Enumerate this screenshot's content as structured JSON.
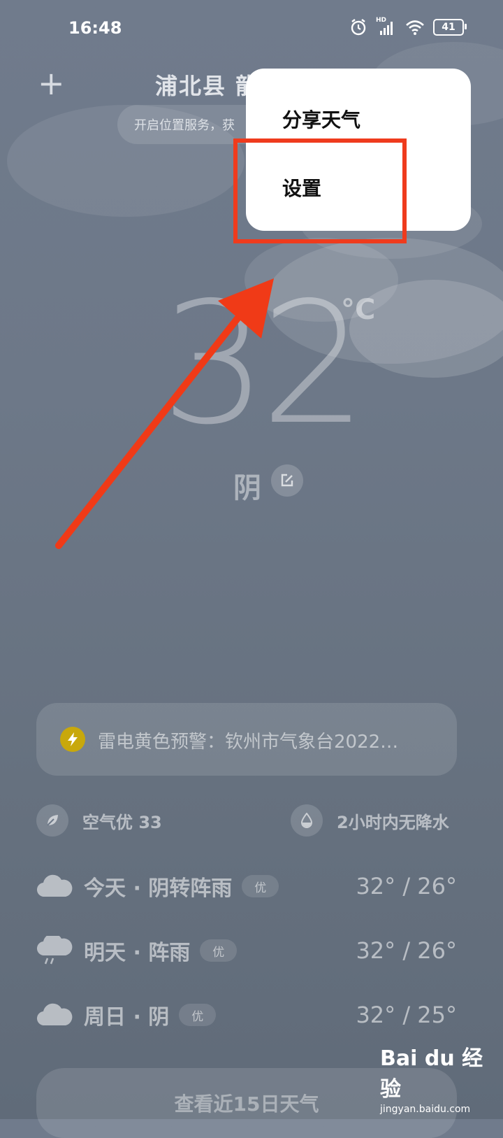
{
  "status": {
    "time": "16:48",
    "battery": "41",
    "network": "HD"
  },
  "header": {
    "add_label": "+",
    "city": "浦北县 龍",
    "location_hint": "开启位置服务，获"
  },
  "menu": {
    "share": "分享天气",
    "settings": "设置"
  },
  "current": {
    "temperature": "32",
    "unit": "°C",
    "condition": "阴"
  },
  "alert": {
    "text": "雷电黄色预警：钦州市气象台2022…",
    "color": "#c8a80b"
  },
  "air": {
    "label": "空气优 33"
  },
  "rain": {
    "label": "2小时内无降水"
  },
  "forecast": [
    {
      "label": "今天 · 阴转阵雨",
      "badge": "优",
      "temp": "32° / 26°",
      "icon": "cloud-icon"
    },
    {
      "label": "明天 · 阵雨",
      "badge": "优",
      "temp": "32° / 26°",
      "icon": "rain-cloud-icon"
    },
    {
      "label": "周日 · 阴",
      "badge": "优",
      "temp": "32° / 25°",
      "icon": "cloud-icon"
    }
  ],
  "bottom_button": "查看近15日天气",
  "watermark": {
    "brand": "Bai du 经验",
    "url": "jingyan.baidu.com"
  },
  "colors": {
    "highlight": "#ef3b1d",
    "arrow": "#f03a17"
  }
}
